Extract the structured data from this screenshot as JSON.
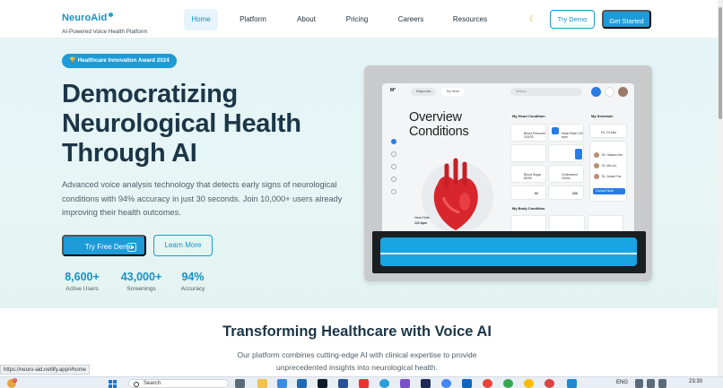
{
  "nav": {
    "brand": "NeuroAid",
    "tagline": "AI-Powered Voice Health Platform",
    "links": [
      "Home",
      "Platform",
      "About",
      "Pricing",
      "Careers",
      "Resources"
    ],
    "try_demo": "Try Demo",
    "get_started": "Get Started",
    "theme_icon": "moon-icon"
  },
  "hero": {
    "badge": "🏆 Healthcare Innovation Award 2024",
    "headline": "Democratizing Neurological Health Through AI",
    "subheadline": "Advanced voice analysis technology that detects early signs of neurological conditions with 94% accuracy in just 30 seconds. Join 10,000+ users already improving their health outcomes.",
    "primary_cta": "Try Free Demo",
    "secondary_cta": "Learn More",
    "stats": [
      {
        "value": "8,600+",
        "label": "Active Users"
      },
      {
        "value": "43,000+",
        "label": "Screenings"
      },
      {
        "value": "94%",
        "label": "Accuracy"
      }
    ]
  },
  "mockup": {
    "logo": "M°",
    "pill_1": "Diagnostic",
    "pill_2": "My Heart",
    "search": "Search...",
    "title_line1": "Overview",
    "title_line2": "Conditions",
    "section_heart": "My Heart Condition",
    "section_schedule": "My Schedule",
    "section_body": "My Body Condition",
    "card_values": [
      "Blood Pressure 118/78",
      "Heart Rate 120 bpm",
      "Blood Sugar 80/90",
      "Cholesterol 200ml",
      "92",
      "220"
    ],
    "schedule_date": "Fri, 24 Mar",
    "doctors": [
      "Dr. Hatsan Jee",
      "Dr. Wu Liu",
      "Dr. Julian Fox"
    ],
    "schedule_button": "Consult Now",
    "heart_rate_label": "Heart Rate",
    "heart_rate_value": "120 bpm"
  },
  "section2": {
    "title": "Transforming Healthcare with Voice AI",
    "description": "Our platform combines cutting-edge AI with clinical expertise to provide unprecedented insights into neurological health."
  },
  "status_url": "https://neuro-aid.netlify.app/#home",
  "taskbar": {
    "search_placeholder": "Search",
    "lang": "ENG",
    "time": "23:30",
    "weather_badge": "6"
  }
}
